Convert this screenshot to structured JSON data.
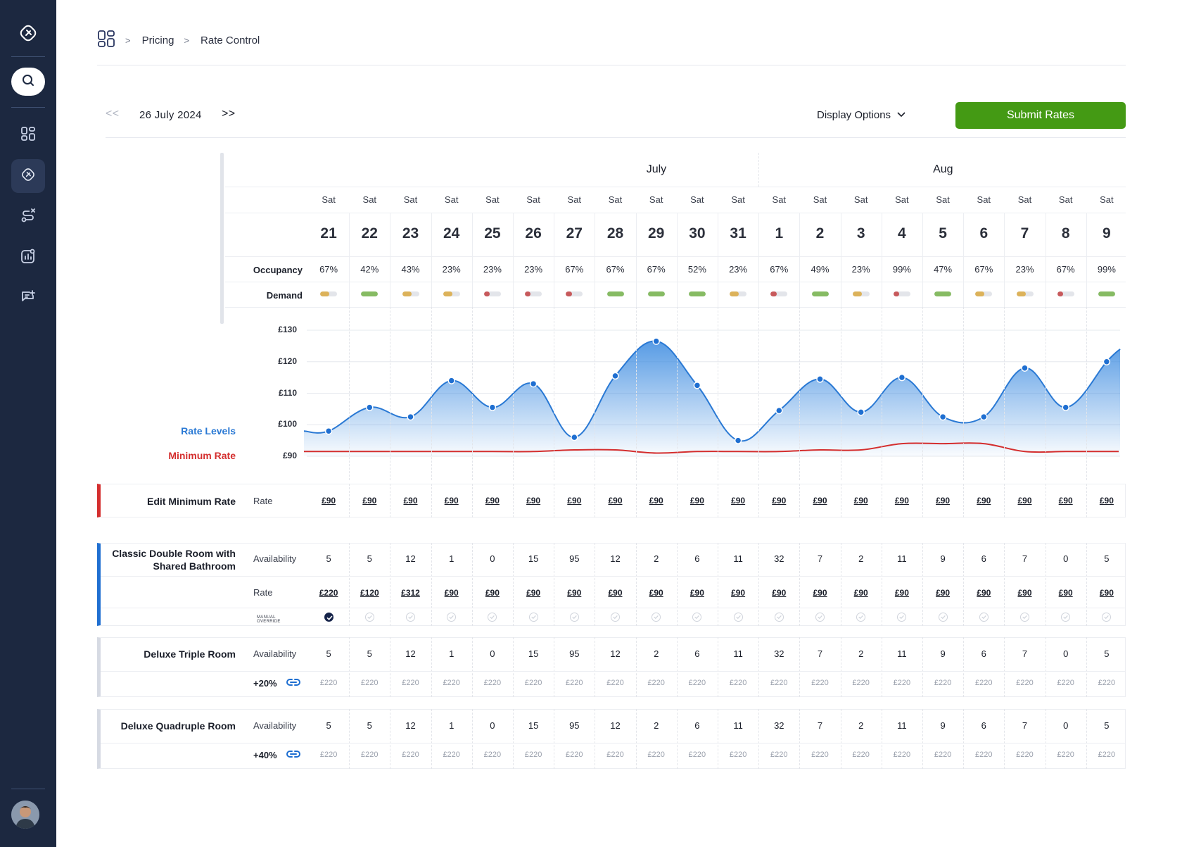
{
  "breadcrumb": {
    "items": [
      "Pricing",
      "Rate Control"
    ]
  },
  "toolbar": {
    "date": "26 July 2024",
    "prev_label": "< <",
    "next_label": "> >",
    "display_options": "Display Options",
    "submit": "Submit Rates"
  },
  "colors": {
    "accent": "#449a14",
    "sidebar": "#1c2840",
    "rate_line": "#2a79d4",
    "min_line": "#d42e2e",
    "demand_low": "#c7595b",
    "demand_mid": "#dcb25a",
    "demand_high": "#86bb63"
  },
  "months": [
    "July",
    "Aug"
  ],
  "labels": {
    "occupancy": "Occupancy",
    "demand": "Demand",
    "rate_levels": "Rate Levels",
    "minimum_rate": "Minimum Rate"
  },
  "days": [
    {
      "dow": "Sat",
      "day": "21",
      "occ": "67%",
      "demand": "mid"
    },
    {
      "dow": "Sat",
      "day": "22",
      "occ": "42%",
      "demand": "high"
    },
    {
      "dow": "Sat",
      "day": "23",
      "occ": "43%",
      "demand": "mid"
    },
    {
      "dow": "Sat",
      "day": "24",
      "occ": "23%",
      "demand": "mid"
    },
    {
      "dow": "Sat",
      "day": "25",
      "occ": "23%",
      "demand": "low"
    },
    {
      "dow": "Sat",
      "day": "26",
      "occ": "23%",
      "demand": "low"
    },
    {
      "dow": "Sat",
      "day": "27",
      "occ": "67%",
      "demand": "low"
    },
    {
      "dow": "Sat",
      "day": "28",
      "occ": "67%",
      "demand": "high"
    },
    {
      "dow": "Sat",
      "day": "29",
      "occ": "67%",
      "demand": "high"
    },
    {
      "dow": "Sat",
      "day": "30",
      "occ": "52%",
      "demand": "high"
    },
    {
      "dow": "Sat",
      "day": "31",
      "occ": "23%",
      "demand": "mid"
    },
    {
      "dow": "Sat",
      "day": "1",
      "occ": "67%",
      "demand": "low"
    },
    {
      "dow": "Sat",
      "day": "2",
      "occ": "49%",
      "demand": "high"
    },
    {
      "dow": "Sat",
      "day": "3",
      "occ": "23%",
      "demand": "mid"
    },
    {
      "dow": "Sat",
      "day": "4",
      "occ": "99%",
      "demand": "low"
    },
    {
      "dow": "Sat",
      "day": "5",
      "occ": "47%",
      "demand": "high"
    },
    {
      "dow": "Sat",
      "day": "6",
      "occ": "67%",
      "demand": "mid"
    },
    {
      "dow": "Sat",
      "day": "7",
      "occ": "23%",
      "demand": "mid"
    },
    {
      "dow": "Sat",
      "day": "8",
      "occ": "67%",
      "demand": "low"
    },
    {
      "dow": "Sat",
      "day": "9",
      "occ": "99%",
      "demand": "high"
    }
  ],
  "chart_data": {
    "type": "area",
    "x": [
      "21",
      "22",
      "23",
      "24",
      "25",
      "26",
      "27",
      "28",
      "29",
      "30",
      "31",
      "1",
      "2",
      "3",
      "4",
      "5",
      "6",
      "7",
      "8",
      "9"
    ],
    "y_ticks": [
      "£130",
      "£120",
      "£110",
      "£100",
      "£90"
    ],
    "ylim": [
      90,
      130
    ],
    "series": [
      {
        "name": "Rate Levels",
        "values": [
          98,
          105.5,
          102.5,
          114,
          105.5,
          113,
          96,
          115.5,
          126.5,
          112.5,
          95,
          104.5,
          114.5,
          104,
          115,
          102.5,
          102.5,
          118,
          105.5,
          120
        ]
      },
      {
        "name": "Minimum Rate",
        "values": [
          91.5,
          91.5,
          91.5,
          91.5,
          91.5,
          91.5,
          92,
          92,
          91,
          91.5,
          91.5,
          91.5,
          92,
          92,
          94,
          94,
          94,
          91.5,
          91.5,
          91.5
        ]
      }
    ]
  },
  "min_rate": {
    "title": "Edit Minimum Rate",
    "sub": "Rate",
    "values": [
      "£90",
      "£90",
      "£90",
      "£90",
      "£90",
      "£90",
      "£90",
      "£90",
      "£90",
      "£90",
      "£90",
      "£90",
      "£90",
      "£90",
      "£90",
      "£90",
      "£90",
      "£90",
      "£90",
      "£90"
    ]
  },
  "rooms": [
    {
      "title_line1": "Classic Double Room with",
      "title_line2": "Shared Bathroom",
      "availability_label": "Availability",
      "rate_label": "Rate",
      "override_label": "MANUAL OVERRIDE",
      "availability": [
        "5",
        "5",
        "12",
        "1",
        "0",
        "15",
        "95",
        "12",
        "2",
        "6",
        "11",
        "32",
        "7",
        "2",
        "11",
        "9",
        "6",
        "7",
        "0",
        "5"
      ],
      "rates": [
        "£220",
        "£120",
        "£312",
        "£90",
        "£90",
        "£90",
        "£90",
        "£90",
        "£90",
        "£90",
        "£90",
        "£90",
        "£90",
        "£90",
        "£90",
        "£90",
        "£90",
        "£90",
        "£90",
        "£90"
      ],
      "override": [
        true,
        false,
        false,
        false,
        false,
        false,
        false,
        false,
        false,
        false,
        false,
        false,
        false,
        false,
        false,
        false,
        false,
        false,
        false,
        false
      ]
    },
    {
      "title": "Deluxe Triple Room",
      "availability_label": "Availability",
      "adjustment": "+20%",
      "availability": [
        "5",
        "5",
        "12",
        "1",
        "0",
        "15",
        "95",
        "12",
        "2",
        "6",
        "11",
        "32",
        "7",
        "2",
        "11",
        "9",
        "6",
        "7",
        "0",
        "5"
      ],
      "rates": [
        "£220",
        "£220",
        "£220",
        "£220",
        "£220",
        "£220",
        "£220",
        "£220",
        "£220",
        "£220",
        "£220",
        "£220",
        "£220",
        "£220",
        "£220",
        "£220",
        "£220",
        "£220",
        "£220",
        "£220"
      ]
    },
    {
      "title": "Deluxe Quadruple Room",
      "availability_label": "Availability",
      "adjustment": "+40%",
      "availability": [
        "5",
        "5",
        "12",
        "1",
        "0",
        "15",
        "95",
        "12",
        "2",
        "6",
        "11",
        "32",
        "7",
        "2",
        "11",
        "9",
        "6",
        "7",
        "0",
        "5"
      ],
      "rates": [
        "£220",
        "£220",
        "£220",
        "£220",
        "£220",
        "£220",
        "£220",
        "£220",
        "£220",
        "£220",
        "£220",
        "£220",
        "£220",
        "£220",
        "£220",
        "£220",
        "£220",
        "£220",
        "£220",
        "£220"
      ]
    }
  ]
}
